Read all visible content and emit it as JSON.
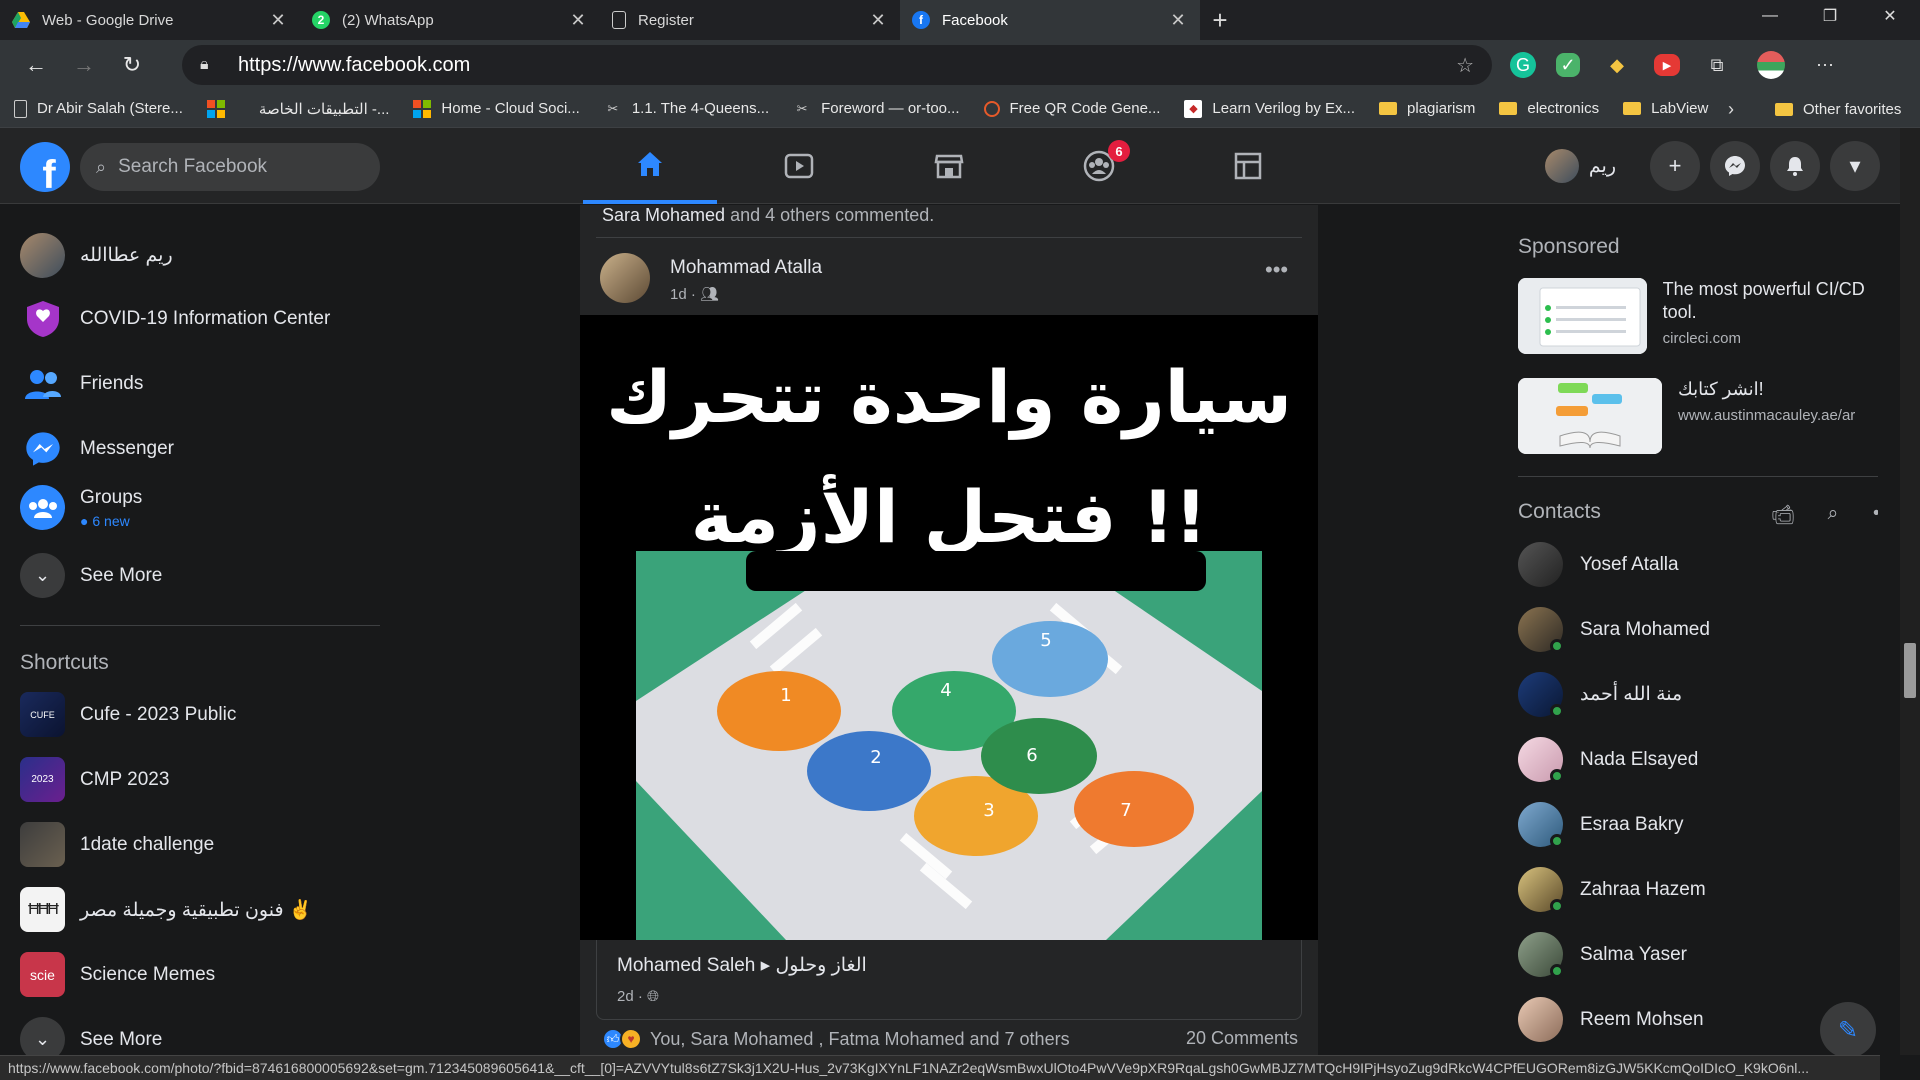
{
  "browser": {
    "tabs": [
      {
        "label": "Web - Google Drive",
        "icon": "google-drive-icon",
        "color": "#34a853",
        "active": false
      },
      {
        "label": "(2) WhatsApp",
        "icon": "whatsapp-icon",
        "color": "#25d366",
        "active": false
      },
      {
        "label": "Register",
        "icon": "document-icon",
        "color": "#5f6368",
        "active": false
      },
      {
        "label": "Facebook",
        "icon": "facebook-icon",
        "color": "#1877f2",
        "active": true
      }
    ],
    "url": "https://www.facebook.com",
    "bookmarks": [
      {
        "label": "Dr Abir Salah (Stere...",
        "icon": "page-icon"
      },
      {
        "label": "",
        "icon": "microsoft-icon"
      },
      {
        "label": "التطبيقات الخاصة -...",
        "icon": ""
      },
      {
        "label": "Home - Cloud Soci...",
        "icon": "microsoft-icon"
      },
      {
        "label": "1.1. The 4-Queens...",
        "icon": "tools-icon"
      },
      {
        "label": "Foreword — or-too...",
        "icon": "tools-icon"
      },
      {
        "label": "Free QR Code Gene...",
        "icon": "qr-icon"
      },
      {
        "label": "Learn Verilog by Ex...",
        "icon": "verilog-icon"
      },
      {
        "label": "plagiarism",
        "icon": "folder-icon"
      },
      {
        "label": "electronics",
        "icon": "folder-icon"
      },
      {
        "label": "LabView",
        "icon": "folder-icon"
      }
    ],
    "other_favorites": "Other favorites",
    "status_url": "https://www.facebook.com/photo/?fbid=874616800005692&set=gm.712345089605641&__cft__[0]=AZVVYtul8s6tZ7Sk3j1X2U-Hus_2v73KgIXYnLF1NAZr2eqWsmBwxUlOto4PwVVe9pXR9RqaLgsh0GwMBJZ7MTQcH9IPjHsyoZug9dRkcW4CPfEUGORem8izGJW5KKcmQoIDIcO_K9kO6nl..."
  },
  "fb": {
    "search_placeholder": "Search Facebook",
    "groups_badge": "6",
    "profile_name": "ريم"
  },
  "left": {
    "items": [
      {
        "label": "ريم عطاالله",
        "icon": "profile-avatar"
      },
      {
        "label": "COVID-19 Information Center",
        "icon": "covid-shield-icon"
      },
      {
        "label": "Friends",
        "icon": "friends-icon"
      },
      {
        "label": "Messenger",
        "icon": "messenger-icon"
      },
      {
        "label": "Groups",
        "icon": "groups-icon",
        "sub": "6 new"
      },
      {
        "label": "See More",
        "icon": "chevron-down-icon"
      }
    ],
    "shortcuts_heading": "Shortcuts",
    "shortcuts": [
      {
        "label": "Cufe - 2023 Public"
      },
      {
        "label": "CMP 2023"
      },
      {
        "label": "1date challenge"
      },
      {
        "label": "فنون تطبيقية وجميلة مصر ✌️"
      },
      {
        "label": "Science Memes"
      },
      {
        "label": "See More"
      }
    ]
  },
  "feed": {
    "commenter_name": "Sara Mohamed",
    "commenter_rest": "and 4 others commented.",
    "author": "Mohammad Atalla",
    "meta": "1d ·",
    "image_line1": "سيارة واحدة تتحرك",
    "image_line2": "فتحل الأزمة !!",
    "car_numbers": [
      "1",
      "2",
      "3",
      "4",
      "5",
      "6",
      "7"
    ],
    "shared_from": "Mohamed Saleh ▸ الغاز وحلول",
    "shared_meta": "2d ·",
    "reactions_text": "You, Sara Mohamed , Fatma Mohamed and 7 others",
    "comments_count": "20 Comments"
  },
  "right": {
    "sponsored_heading": "Sponsored",
    "ads": [
      {
        "title": "The most powerful CI/CD tool.",
        "url": "circleci.com"
      },
      {
        "title": "انشر كتابك!",
        "url": "www.austinmacauley.ae/ar"
      }
    ],
    "contacts_heading": "Contacts",
    "contacts": [
      {
        "name": "Yosef Atalla",
        "online": false
      },
      {
        "name": "Sara Mohamed",
        "online": true
      },
      {
        "name": "منة الله أحمد",
        "online": true
      },
      {
        "name": "Nada Elsayed",
        "online": true
      },
      {
        "name": "Esraa Bakry",
        "online": true
      },
      {
        "name": "Zahraa Hazem",
        "online": true
      },
      {
        "name": "Salma Yaser",
        "online": true
      },
      {
        "name": "Reem Mohsen",
        "online": false
      }
    ]
  },
  "colors": {
    "accent": "#2d88ff",
    "bg": "#18191a",
    "card": "#242526",
    "badge": "#e41e3f",
    "online": "#31a24c"
  }
}
